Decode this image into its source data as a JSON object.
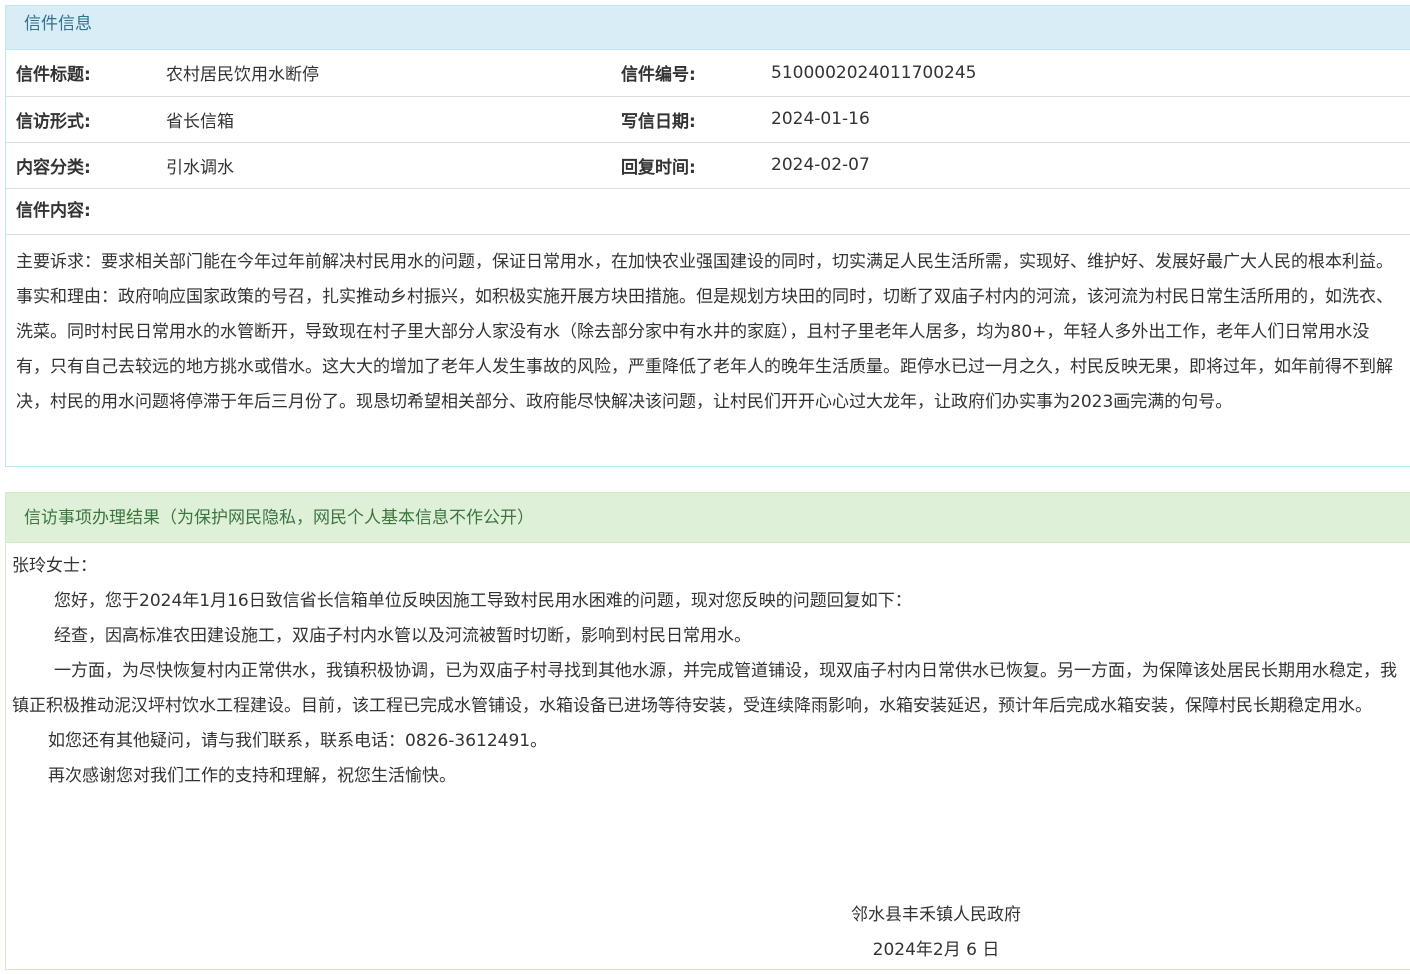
{
  "letter_info": {
    "heading": "信件信息",
    "title_label": "信件标题:",
    "title_value": "农村居民饮用水断停",
    "number_label": "信件编号:",
    "number_value": "5100002024011700245",
    "form_label": "信访形式:",
    "form_value": "省长信箱",
    "date_label": "写信日期:",
    "date_value": "2024-01-16",
    "category_label": "内容分类:",
    "category_value": "引水调水",
    "reply_time_label": "回复时间:",
    "reply_time_value": "2024-02-07",
    "content_label": "信件内容:",
    "content_p1": "主要诉求：要求相关部门能在今年过年前解决村民用水的问题，保证日常用水，在加快农业强国建设的同时，切实满足人民生活所需，实现好、维护好、发展好最广大人民的根本利益。",
    "content_p2": "事实和理由：政府响应国家政策的号召，扎实推动乡村振兴，如积极实施开展方块田措施。但是规划方块田的同时，切断了双庙子村内的河流，该河流为村民日常生活所用的，如洗衣、洗菜。同时村民日常用水的水管断开，导致现在村子里大部分人家没有水（除去部分家中有水井的家庭），且村子里老年人居多，均为80+，年轻人多外出工作，老年人们日常用水没有，只有自己去较远的地方挑水或借水。这大大的增加了老年人发生事故的风险，严重降低了老年人的晚年生活质量。距停水已过一月之久，村民反映无果，即将过年，如年前得不到解决，村民的用水问题将停滞于年后三月份了。现恳切希望相关部分、政府能尽快解决该问题，让村民们开开心心过大龙年，让政府们办实事为2023画完满的句号。"
  },
  "result": {
    "heading": "信访事项办理结果（为保护网民隐私，网民个人基本信息不作公开）",
    "salutation": "张玲女士：",
    "p1": "您好，您于2024年1月16日致信省长信箱单位反映因施工导致村民用水困难的问题，现对您反映的问题回复如下：",
    "p2": "经查，因高标准农田建设施工，双庙子村内水管以及河流被暂时切断，影响到村民日常用水。",
    "p3": "一方面，为尽快恢复村内正常供水，我镇积极协调，已为双庙子村寻找到其他水源，并完成管道铺设，现双庙子村内日常供水已恢复。另一方面，为保障该处居民长期用水稳定，我镇正积极推动泥汉坪村饮水工程建设。目前，该工程已完成水管铺设，水箱设备已进场等待安装，受连续降雨影响，水箱安装延迟，预计年后完成水箱安装，保障村民长期稳定用水。",
    "p4": "如您还有其他疑问，请与我们联系，联系电话：0826-3612491。",
    "p5": "再次感谢您对我们工作的支持和理解，祝您生活愉快。",
    "signature_org": "邻水县丰禾镇人民政府",
    "signature_date": "2024年2月 6 日"
  }
}
